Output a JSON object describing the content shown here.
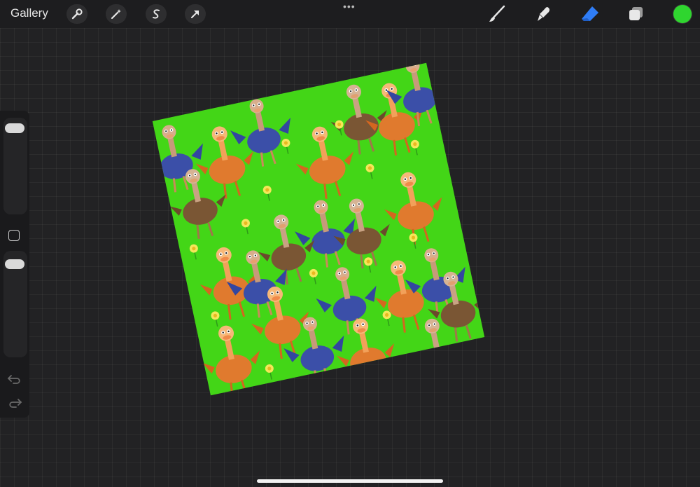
{
  "toolbar": {
    "gallery_label": "Gallery",
    "more_label": "•••",
    "left_tools": [
      "wrench-icon",
      "magic-wand-icon",
      "selection-s-icon",
      "transform-arrow-icon"
    ],
    "right_tools": [
      "brush-icon",
      "smudge-icon",
      "eraser-icon",
      "layers-icon"
    ],
    "eraser_active_color": "#2f7df6",
    "current_color": "#2fd52f"
  },
  "sidebar": {
    "brush_size_level": 0.96,
    "opacity_level": 0.95,
    "modify_button": "square-icon",
    "undo": "undo-icon",
    "redo": "redo-icon"
  },
  "canvas": {
    "background_color": "#43d617",
    "pattern": "ostriches-and-daisies",
    "rotation_deg": -12
  }
}
